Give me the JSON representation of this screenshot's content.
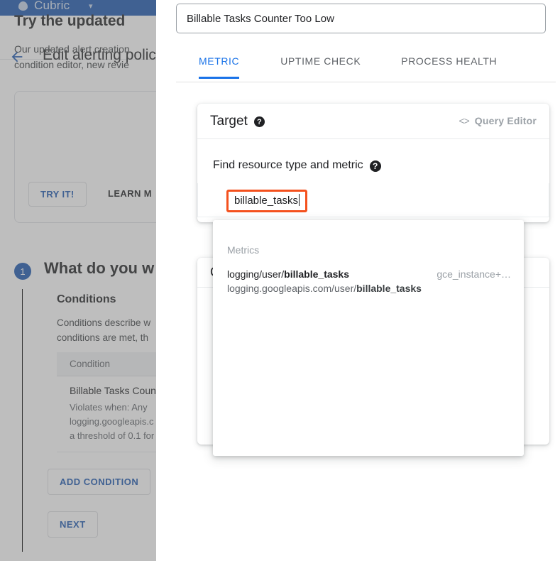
{
  "background": {
    "topbar": {
      "product": "Cubric",
      "caret": "▾",
      "logo_icon": "shield-icon"
    },
    "header": {
      "back_icon": "back-arrow-icon",
      "title": "Edit alerting policy"
    },
    "promo": {
      "title": "Try the updated",
      "body": "Our updated alert creation\ncondition editor, new revie",
      "try_button": "TRY IT!",
      "learn_button": "LEARN M"
    },
    "step": {
      "number": "1",
      "title": "What do you w",
      "subtitle": "Conditions",
      "body": "Conditions describe w\nconditions are met, th",
      "table": {
        "header": "Condition",
        "row_title": "Billable Tasks Coun",
        "row_sub": "Violates when: Any\nlogging.googleapis.c\na threshold of 0.1 for"
      },
      "add_condition_button": "ADD CONDITION",
      "next_button": "NEXT"
    }
  },
  "panel": {
    "name_value": "Billable Tasks Counter Too Low",
    "tabs": [
      {
        "label": "METRIC",
        "active": true
      },
      {
        "label": "UPTIME CHECK",
        "active": false
      },
      {
        "label": "PROCESS HEALTH",
        "active": false
      }
    ],
    "target_card": {
      "title": "Target",
      "help_icon": "help-icon",
      "query_editor_label": "Query Editor",
      "code_icon": "code-brackets-icon"
    },
    "find_label": "Find resource type and metric",
    "search": {
      "value": "billable_tasks",
      "highlight_color": "#f4511e"
    },
    "second_card": {
      "title": "C"
    },
    "dropdown": {
      "section_label": "Metrics",
      "item": {
        "line1_prefix": "logging/user/",
        "line1_bold": "billable_tasks",
        "line2_prefix": "logging.googleapis.com/user/",
        "line2_bold": "billable_tasks",
        "resource": "gce_instance+…"
      }
    }
  }
}
